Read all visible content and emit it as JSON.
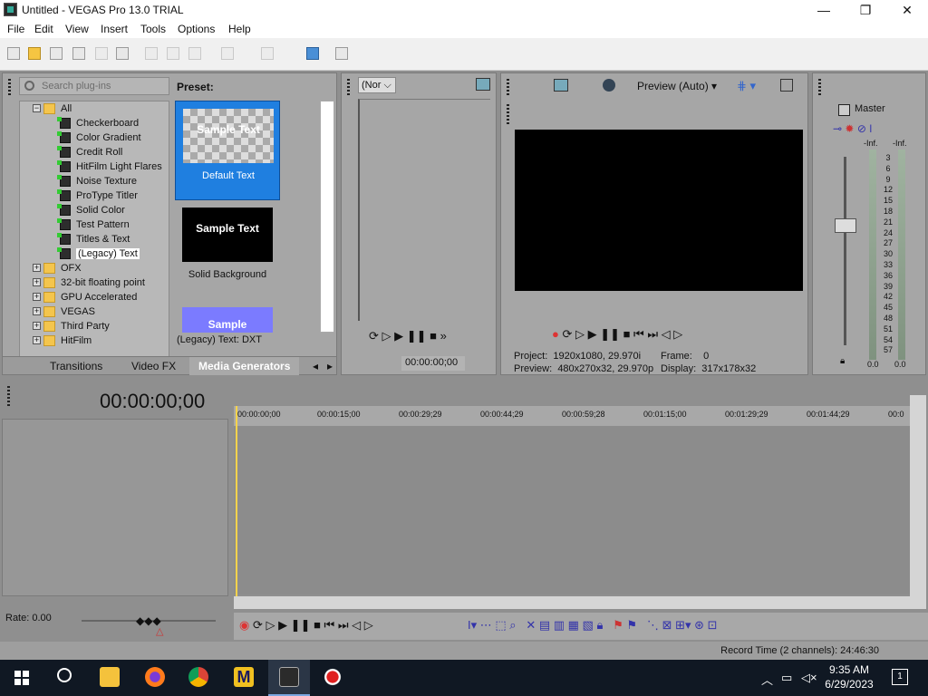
{
  "window": {
    "title": "Untitled - VEGAS Pro 13.0 TRIAL",
    "minimize": "—",
    "maximize": "❐",
    "close": "✕"
  },
  "menu": [
    "File",
    "Edit",
    "View",
    "Insert",
    "Tools",
    "Options",
    "Help"
  ],
  "plugins": {
    "search_placeholder": "Search plug-ins",
    "preset_label": "Preset:",
    "tree": [
      {
        "label": "All",
        "type": "folder",
        "expanded": true
      },
      {
        "label": "Checkerboard",
        "type": "plugin"
      },
      {
        "label": "Color Gradient",
        "type": "plugin"
      },
      {
        "label": "Credit Roll",
        "type": "plugin"
      },
      {
        "label": "HitFilm Light Flares",
        "type": "plugin"
      },
      {
        "label": "Noise Texture",
        "type": "plugin"
      },
      {
        "label": "ProType Titler",
        "type": "plugin"
      },
      {
        "label": "Solid Color",
        "type": "plugin"
      },
      {
        "label": "Test Pattern",
        "type": "plugin"
      },
      {
        "label": "Titles & Text",
        "type": "plugin"
      },
      {
        "label": "(Legacy) Text",
        "type": "plugin",
        "selected": true
      },
      {
        "label": "OFX",
        "type": "folder"
      },
      {
        "label": "32-bit floating point",
        "type": "folder"
      },
      {
        "label": "GPU Accelerated",
        "type": "folder"
      },
      {
        "label": "VEGAS",
        "type": "folder"
      },
      {
        "label": "Third Party",
        "type": "folder"
      },
      {
        "label": "HitFilm",
        "type": "folder"
      }
    ],
    "presets": [
      {
        "thumb_text": "Sample Text",
        "label": "Default Text",
        "selected": true
      },
      {
        "thumb_text": "Sample Text",
        "label": "Solid Background"
      },
      {
        "thumb_text": "Sample",
        "label": ""
      }
    ],
    "preset_description": "(Legacy) Text: DXT",
    "tabs": [
      "Transitions",
      "Video FX",
      "Media Generators"
    ],
    "active_tab": "Media Generators"
  },
  "trimmer": {
    "dropdown": "(Nor",
    "timecode": "00:00:00;00"
  },
  "preview": {
    "quality": "Preview (Auto)",
    "project_label": "Project:",
    "project_value": "1920x1080, 29.970i",
    "preview_label": "Preview:",
    "preview_value": "480x270x32, 29.970p",
    "frame_label": "Frame:",
    "frame_value": "0",
    "display_label": "Display:",
    "display_value": "317x178x32"
  },
  "master": {
    "title": "Master",
    "inf_left": "-Inf.",
    "inf_right": "-Inf.",
    "scale": [
      "3",
      "6",
      "9",
      "12",
      "15",
      "18",
      "21",
      "24",
      "27",
      "30",
      "33",
      "36",
      "39",
      "42",
      "45",
      "48",
      "51",
      "54",
      "57"
    ],
    "bottom_left": "0.0",
    "bottom_right": "0.0"
  },
  "timeline": {
    "timecode": "00:00:00;00",
    "ruler": [
      "00:00:00;00",
      "00:00:15;00",
      "00:00:29;29",
      "00:00:44;29",
      "00:00:59;28",
      "00:01:15;00",
      "00:01:29;29",
      "00:01:44;29",
      "00:0"
    ],
    "rate": "Rate: 0.00"
  },
  "status": {
    "record_time": "Record Time (2 channels): 24:46:30"
  },
  "taskbar": {
    "time": "9:35 AM",
    "date": "6/29/2023",
    "notifications": "1"
  },
  "colors": {
    "accent": "#1f7fe0",
    "panel": "#a6a6a6",
    "taskbar": "#101823"
  }
}
